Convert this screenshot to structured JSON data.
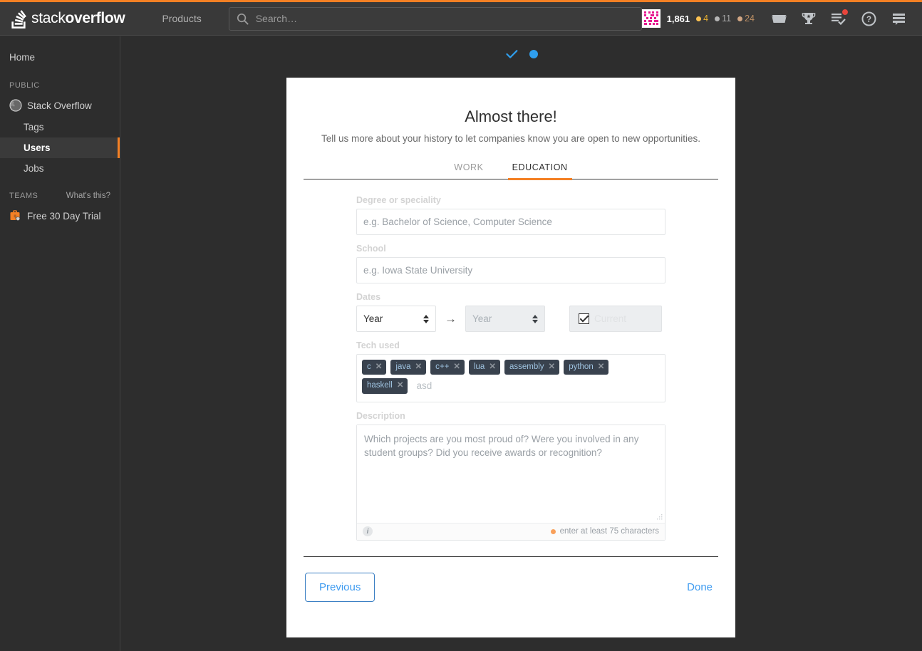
{
  "header": {
    "logo_text_light": "stack",
    "logo_text_bold": "overflow",
    "products_label": "Products",
    "search_placeholder": "Search…",
    "search_value": "",
    "reputation": "1,861",
    "badges": {
      "gold": "4",
      "silver": "11",
      "bronze": "24"
    },
    "icons": {
      "inbox": "inbox-icon",
      "achievements": "trophy-icon",
      "review": "review-queue-icon",
      "help": "help-icon",
      "site_switcher": "site-switcher-icon"
    }
  },
  "sidebar": {
    "home_label": "Home",
    "public_label": "PUBLIC",
    "public_items": [
      {
        "label": "Stack Overflow",
        "level": "parent",
        "selected": false,
        "icon": "globe-icon"
      },
      {
        "label": "Tags",
        "level": "child",
        "selected": false
      },
      {
        "label": "Users",
        "level": "child",
        "selected": true
      },
      {
        "label": "Jobs",
        "level": "child",
        "selected": false
      }
    ],
    "teams_label": "TEAMS",
    "teams_help": "What's this?",
    "teams_item": {
      "label": "Free 30 Day Trial",
      "icon": "briefcase-shield-icon"
    }
  },
  "progress": {
    "step1": "check",
    "step2": "dot"
  },
  "modal": {
    "title": "Almost there!",
    "subtitle": "Tell us more about your history to let companies know you are open to new opportunities.",
    "tabs": [
      {
        "label": "WORK",
        "active": false
      },
      {
        "label": "EDUCATION",
        "active": true
      }
    ],
    "fields": {
      "degree": {
        "label": "Degree or speciality",
        "placeholder": "e.g. Bachelor of Science, Computer Science",
        "value": ""
      },
      "school": {
        "label": "School",
        "placeholder": "e.g. Iowa State University",
        "value": ""
      },
      "dates": {
        "label": "Dates",
        "start_value": "Year",
        "end_value": "Year",
        "end_disabled": true,
        "separator": "→",
        "current_label": "Current",
        "current_checked": true
      },
      "tech": {
        "label": "Tech used",
        "tags": [
          "c",
          "java",
          "c++",
          "lua",
          "assembly",
          "python",
          "haskell"
        ],
        "remove_glyph": "✕",
        "typed_value": "asd"
      },
      "description": {
        "label": "Description",
        "placeholder": "Which projects are you most proud of? Were you involved in any student groups? Did you receive awards or recognition?",
        "value": "",
        "info_glyph": "i",
        "hint": "enter at least 75 characters"
      }
    },
    "footer": {
      "previous_label": "Previous",
      "done_label": "Done"
    }
  },
  "colors": {
    "accent_orange": "#f48024",
    "link_blue": "#3e9bf0",
    "progress_blue": "#2f9fee",
    "tag_bg": "#39424e",
    "tag_text": "#9fc3e0",
    "hint_orange": "#f9a05a",
    "dark_bg": "#2d2d2d"
  }
}
